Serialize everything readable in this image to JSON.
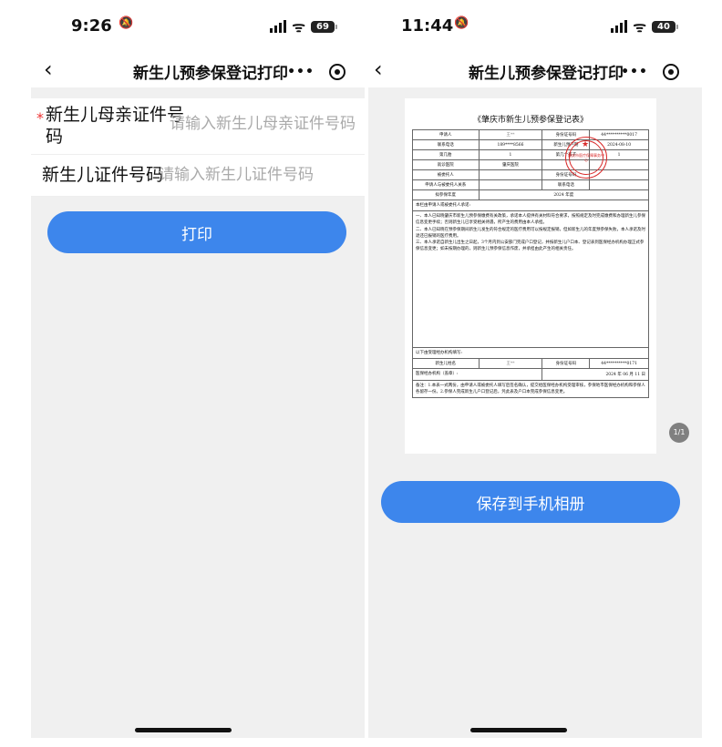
{
  "left": {
    "status": {
      "time": "9:26",
      "battery": "69"
    },
    "nav": {
      "back": "‹",
      "title": "新生儿预参保登记打印",
      "more": "•••"
    },
    "form": {
      "mother_id": {
        "label_line1": "新生儿母亲证件号",
        "label_line2": "码",
        "placeholder": "请输入新生儿母亲证件号码",
        "required": "*"
      },
      "baby_id": {
        "label": "新生儿证件号码",
        "placeholder": "请输入新生儿证件号码"
      }
    },
    "print_button": "打印"
  },
  "right": {
    "status": {
      "time": "11:44",
      "battery": "40"
    },
    "nav": {
      "back": "‹",
      "title": "新生儿预参保登记打印",
      "more": "•••"
    },
    "save_button": "保存到手机相册",
    "page_indicator": "1/1",
    "document": {
      "title": "《肇庆市新生儿预参保登记表》",
      "rows": [
        [
          "申请人",
          "王**",
          "身份证号码",
          "44**********0017"
        ],
        [
          "联系电话",
          "189****8566",
          "新生儿预产期",
          "2024-08-10"
        ],
        [
          "第几胎",
          "1",
          "第几个孩子",
          "1"
        ],
        [
          "就诊医院",
          "肇庆医院",
          "",
          ""
        ],
        [
          "被委托人",
          "",
          "身份证号码",
          ""
        ],
        [
          "申请人与被委托人关系",
          "",
          "联系电话",
          ""
        ],
        [
          "拟参保年度",
          "2024 年度",
          "",
          ""
        ]
      ],
      "commitment_title": "本栏由申请人或被委托人承诺:",
      "commitments": [
        "一、本人已知晓肇庆市新生儿预参保缴费有关政策，承诺本人提供有关材料符合要求，按照规定及时完成缴费和办理新生儿参保信息变更手续；否则新生儿已享受相关待遇，所产生的费用由本人承担。",
        "二、本人已知晓在预参保期间新生儿发生的符合规定的医疗费用可以按规定报销，但如新生儿的年度预参保失败，本人承诺及时退还已报销的医疗费用。",
        "三、本人承诺自新生儿出生之日起，3个月内到公安部门完成户口登记，并按新生儿户口本、登记表到医保经办机构办理正式参保信息变更；如未按期办理的，则新生儿预参保信息作废，并承担由此产生的相关责任。"
      ],
      "agent_title": "以下由受理经办机构填写:",
      "baby_name_label": "新生儿姓名",
      "baby_name_value": "王**",
      "baby_id_label": "身份证号码",
      "baby_id_value": "44**********0171",
      "agency_label": "医保经办机构（盖章）:",
      "date_text": "2024 年 06 月 11 日",
      "remarks": "备注：1.本表一式两份，由申请人或被委托人填写后签名确认，提交给医保经办机构受理审核，参保地市医保经办机构和参保人各留存一份。2.参保人完成新生儿户口登记后，凭此表及户口本完成参保信息变更。",
      "stamp_text": "肇庆市医疗保障事务中心"
    }
  }
}
